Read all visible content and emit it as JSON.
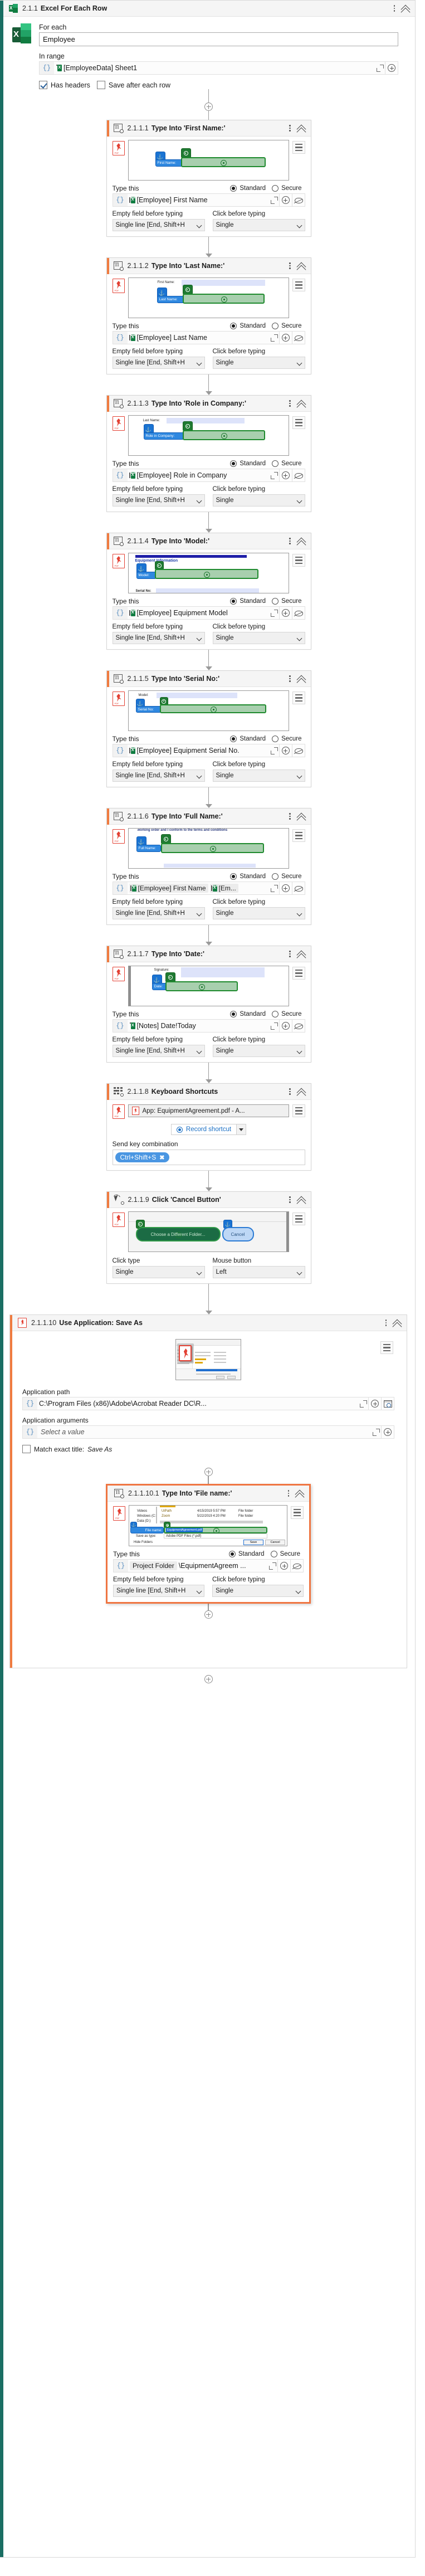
{
  "root": {
    "header": {
      "number": "2.1.1",
      "title": "Excel For Each Row",
      "icon": "excel-icon"
    },
    "for_each_label": "For each",
    "for_each_value": "Employee",
    "in_range_label": "In range",
    "in_range_value": "[EmployeeData] Sheet1",
    "has_headers_label": "Has headers",
    "has_headers_checked": true,
    "save_after_each_row_label": "Save after each row",
    "save_after_each_row_checked": false
  },
  "labels": {
    "type_this": "Type this",
    "standard": "Standard",
    "secure": "Secure",
    "empty_field_before_typing": "Empty field before typing",
    "click_before_typing": "Click before typing",
    "click_type": "Click type",
    "mouse_button": "Mouse button",
    "send_key_combination": "Send key combination",
    "record_shortcut": "Record shortcut",
    "application_path": "Application path",
    "application_arguments": "Application arguments",
    "match_exact_title_prefix": "Match exact title:",
    "match_exact_title_value": "Save As",
    "select_a_value": "Select a value"
  },
  "steps": [
    {
      "number": "2.1.1.1",
      "title": "Type Into 'First Name:'",
      "icon": "type-into-icon",
      "target_app": "pdf-icon",
      "anchor_label": "First Name:",
      "shot_prev_label": "",
      "type_mode": "Standard",
      "type_value": "[Employee] First Name",
      "type_value_prefix": "",
      "empty_field": "Single line [End, Shift+H",
      "click_before": "Single",
      "selected": false
    },
    {
      "number": "2.1.1.2",
      "title": "Type Into 'Last Name:'",
      "icon": "type-into-icon",
      "target_app": "pdf-icon",
      "anchor_label": "Last Name:",
      "shot_prev_label": "First Name:",
      "type_mode": "Standard",
      "type_value": "[Employee] Last Name",
      "empty_field": "Single line [End, Shift+H",
      "click_before": "Single",
      "selected": false
    },
    {
      "number": "2.1.1.3",
      "title": "Type Into 'Role in Company:'",
      "icon": "type-into-icon",
      "target_app": "pdf-icon",
      "anchor_label": "Role in Company:",
      "shot_prev_label": "Last Name:",
      "type_mode": "Standard",
      "type_value": "[Employee] Role in Company",
      "empty_field": "Single line [End, Shift+H",
      "click_before": "Single",
      "selected": false
    },
    {
      "number": "2.1.1.4",
      "title": "Type Into 'Model:'",
      "icon": "type-into-icon",
      "target_app": "pdf-icon",
      "anchor_label": "Model:",
      "shot_prev_label": "Equipment Information",
      "shot_extra_label": "Serial No:",
      "type_mode": "Standard",
      "type_value": "[Employee] Equipment Model",
      "empty_field": "Single line [End, Shift+H",
      "click_before": "Single",
      "selected": false
    },
    {
      "number": "2.1.1.5",
      "title": "Type Into 'Serial No:'",
      "icon": "type-into-icon",
      "target_app": "pdf-icon",
      "anchor_label": "Serial No:",
      "shot_prev_label": "Model:",
      "type_mode": "Standard",
      "type_value": "[Employee] Equipment Serial No.",
      "empty_field": "Single line [End, Shift+H",
      "click_before": "Single",
      "selected": false
    },
    {
      "number": "2.1.1.6",
      "title": "Type Into 'Full Name:'",
      "icon": "type-into-icon",
      "target_app": "pdf-icon",
      "anchor_label": "Full Name:",
      "shot_prev_label": "working order and I conform to the terms and conditions",
      "type_mode": "Standard",
      "type_value_chip1": "[Employee] First Name",
      "type_value_chip2": "[Em...",
      "empty_field": "Single line [End, Shift+H",
      "click_before": "Single",
      "selected": false
    },
    {
      "number": "2.1.1.7",
      "title": "Type Into 'Date:'",
      "icon": "type-into-icon",
      "target_app": "pdf-icon",
      "anchor_label": "Date:",
      "shot_prev_label": "Signature:",
      "type_mode": "Standard",
      "type_value": "[Notes] Date!Today",
      "empty_field": "Single line [End, Shift+H",
      "click_before": "Single",
      "selected": false
    }
  ],
  "keyboard_step": {
    "number": "2.1.1.8",
    "title": "Keyboard Shortcuts",
    "icon": "keyboard-shortcuts-icon",
    "app_target": "App: EquipmentAgreement.pdf - A...",
    "record_shortcut": "Record shortcut",
    "send_key_combination_label": "Send key combination",
    "key_combo": "Ctrl+Shift+S"
  },
  "click_step": {
    "number": "2.1.1.9",
    "title": "Click 'Cancel Button'",
    "icon": "click-icon",
    "target_button_label": "Choose a Different Folder...",
    "anchor_button_label": "Cancel",
    "click_type_label": "Click type",
    "click_type_value": "Single",
    "mouse_button_label": "Mouse button",
    "mouse_button_value": "Left"
  },
  "use_app_step": {
    "number": "2.1.1.10",
    "title": "Use Application: Save As",
    "icon": "pdf-icon",
    "application_path_label": "Application path",
    "application_path_value": "C:\\Program Files (x86)\\Adobe\\Acrobat Reader DC\\R...",
    "application_arguments_label": "Application arguments",
    "application_arguments_placeholder": "Select a value",
    "match_exact_title_label": "Match exact title:",
    "match_exact_title_value": "Save As",
    "match_exact_title_checked": false,
    "nested_step": {
      "number": "2.1.1.10.1",
      "title": "Type Into 'File name:'",
      "icon": "type-into-icon",
      "type_mode": "Standard",
      "type_value_chip": "Project Folder",
      "type_value_rest": "\\EquipmentAgreem ...",
      "empty_field": "Single line [End, Shift+H",
      "click_before": "Single",
      "selected": true,
      "shot": {
        "tree_items": [
          "Videos",
          "Windows (C:)",
          "Data (D:)"
        ],
        "rows": [
          {
            "name": "UiPath",
            "date": "4/15/2019 5:57 PM",
            "type": "File folder"
          },
          {
            "name": "Zoom",
            "date": "5/22/2019 4:20 PM",
            "type": "File folder"
          }
        ],
        "file_name_label": "File name:",
        "file_name_value": "EquipmentAgreement.pdf",
        "save_as_type_label": "Save as type:",
        "save_as_type_value": "Adobe PDF Files (*.pdf)",
        "hide_folders": "Hide Folders",
        "save_btn": "Save",
        "cancel_btn": "Cancel"
      }
    }
  },
  "colors": {
    "excel_accent": "#1a6e63",
    "step_accent": "#f07b3f",
    "selected_border": "#ef7541",
    "target_green": "#1f8a2e",
    "anchor_blue": "#1a73d2",
    "key_pill_blue": "#4a96e2",
    "link_blue": "#1a6fc4"
  }
}
